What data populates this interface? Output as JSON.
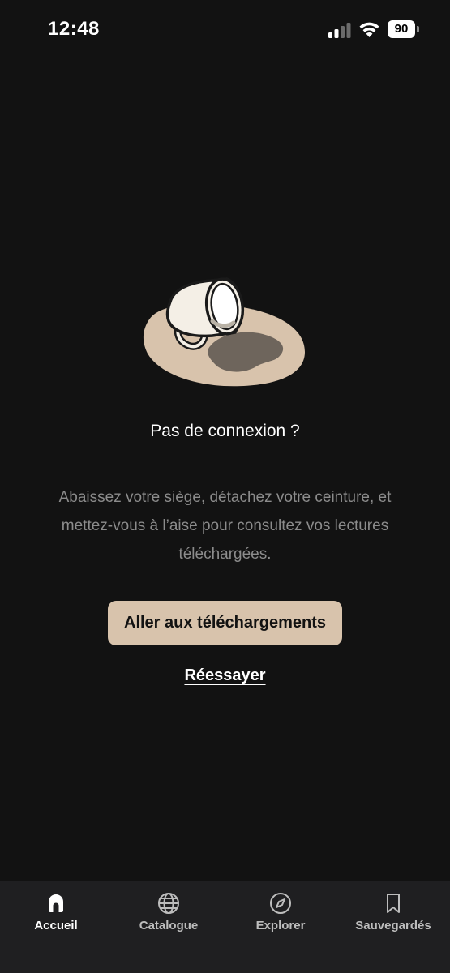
{
  "status_bar": {
    "time": "12:48",
    "battery_level": "90",
    "icons": [
      "signal-icon",
      "wifi-icon",
      "battery-icon"
    ]
  },
  "empty_state": {
    "illustration": "spilled-cup-illustration",
    "title": "Pas de connexion ?",
    "description": "Abaissez votre siège, détachez votre ceinture, et mettez-vous à l’aise pour consultez vos lectures téléchargées.",
    "primary_button": "Aller aux téléchargements",
    "retry_link": "Réessayer"
  },
  "tab_bar": {
    "active_tab": "Accueil",
    "tabs": [
      {
        "label": "Accueil",
        "icon": "home-icon"
      },
      {
        "label": "Catalogue",
        "icon": "globe-icon"
      },
      {
        "label": "Explorer",
        "icon": "compass-icon"
      },
      {
        "label": "Sauvegardés",
        "icon": "bookmark-icon"
      }
    ]
  },
  "colors": {
    "background": "#121212",
    "accent": "#d8c3ac",
    "tab_bar": "#1f1f21",
    "muted_text": "#8c8c8c"
  }
}
